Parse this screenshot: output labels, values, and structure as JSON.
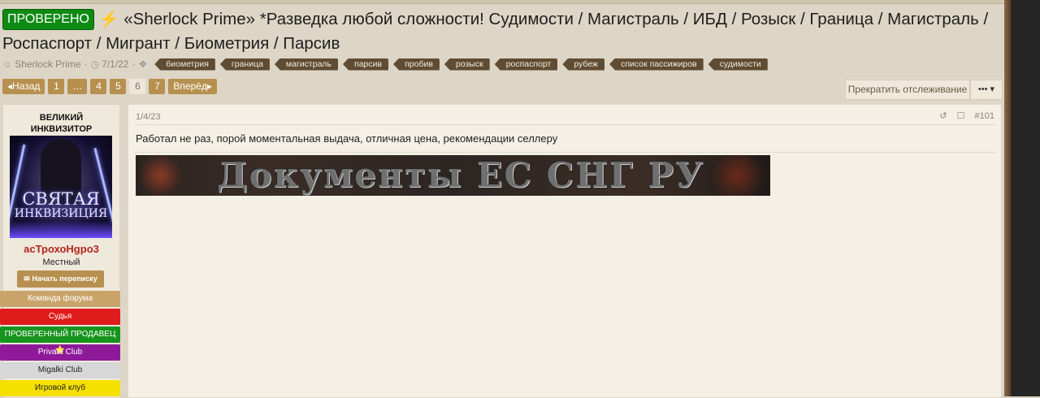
{
  "thread": {
    "badge": "ПРОВЕРЕНО",
    "bolt": "⚡",
    "title": "«Sherlock Prime» *Разведка любой сложности! Судимости / Магистраль / ИБД / Розыск / Граница / Магистраль / Роспаспорт / Мигрант / Биометрия / Парсив"
  },
  "meta": {
    "author": "Sherlock Prime",
    "date": "7/1/22",
    "tags": [
      "биометрия",
      "граница",
      "магистраль",
      "парсив",
      "пробив",
      "розыск",
      "роспаспорт",
      "рубеж",
      "список пассижиров",
      "судимости"
    ]
  },
  "pagination": {
    "prev": "◂Назад",
    "items": [
      "1",
      "…",
      "4",
      "5",
      "6",
      "7"
    ],
    "current": "6",
    "next": "Вперёд▸"
  },
  "actions": {
    "watch": "Прекратить отслеживание",
    "menu": "••• ▾"
  },
  "user": {
    "title_line1": "ВЕЛИКИЙ",
    "title_line2": "ИНКВИЗИТОР",
    "avatar_line1": "СВЯТАЯ",
    "avatar_line2": "ИНКВИЗИЦИЯ",
    "name": "асТрохоНgро3",
    "rank": "Местный",
    "pm_button": "✉  Начать переписку",
    "banners": [
      {
        "label": "Команда форума",
        "bg": "#c9a46a",
        "fg": "#ffffff"
      },
      {
        "label": "Судья",
        "bg": "#e01b1b",
        "fg": "#ffffff"
      },
      {
        "label": "ПРОВЕРЕННЫЙ ПРОДАВЕЦ ⭐",
        "bg": "#16941c",
        "fg": "#ffffff"
      },
      {
        "label": "Private Club",
        "bg": "#8e1a9a",
        "fg": "#ffffff"
      },
      {
        "label": "Migalki Club",
        "bg": "#d7d7d7",
        "fg": "#222222"
      },
      {
        "label": "Игровой клуб",
        "bg": "#f5e000",
        "fg": "#222222"
      }
    ]
  },
  "post": {
    "date": "1/4/23",
    "number": "#101",
    "text": "Работал не раз, порой моментальная выдача, отличная цена, рекомендации селлеру",
    "signature_text": "Документы ЕС СНГ РУ"
  }
}
